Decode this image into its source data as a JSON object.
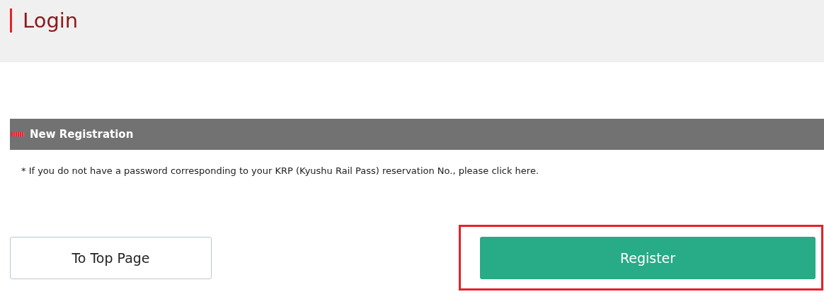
{
  "header": {
    "title": "Login"
  },
  "section": {
    "title": "New Registration",
    "note": "* If you do not have a password corresponding to your KRP (Kyushu Rail Pass) reservation No., please click here."
  },
  "buttons": [
    {
      "kind": "secondary",
      "label": "To Top Page",
      "highlighted": false
    },
    {
      "kind": "primary",
      "label": "Register",
      "highlighted": true
    }
  ]
}
